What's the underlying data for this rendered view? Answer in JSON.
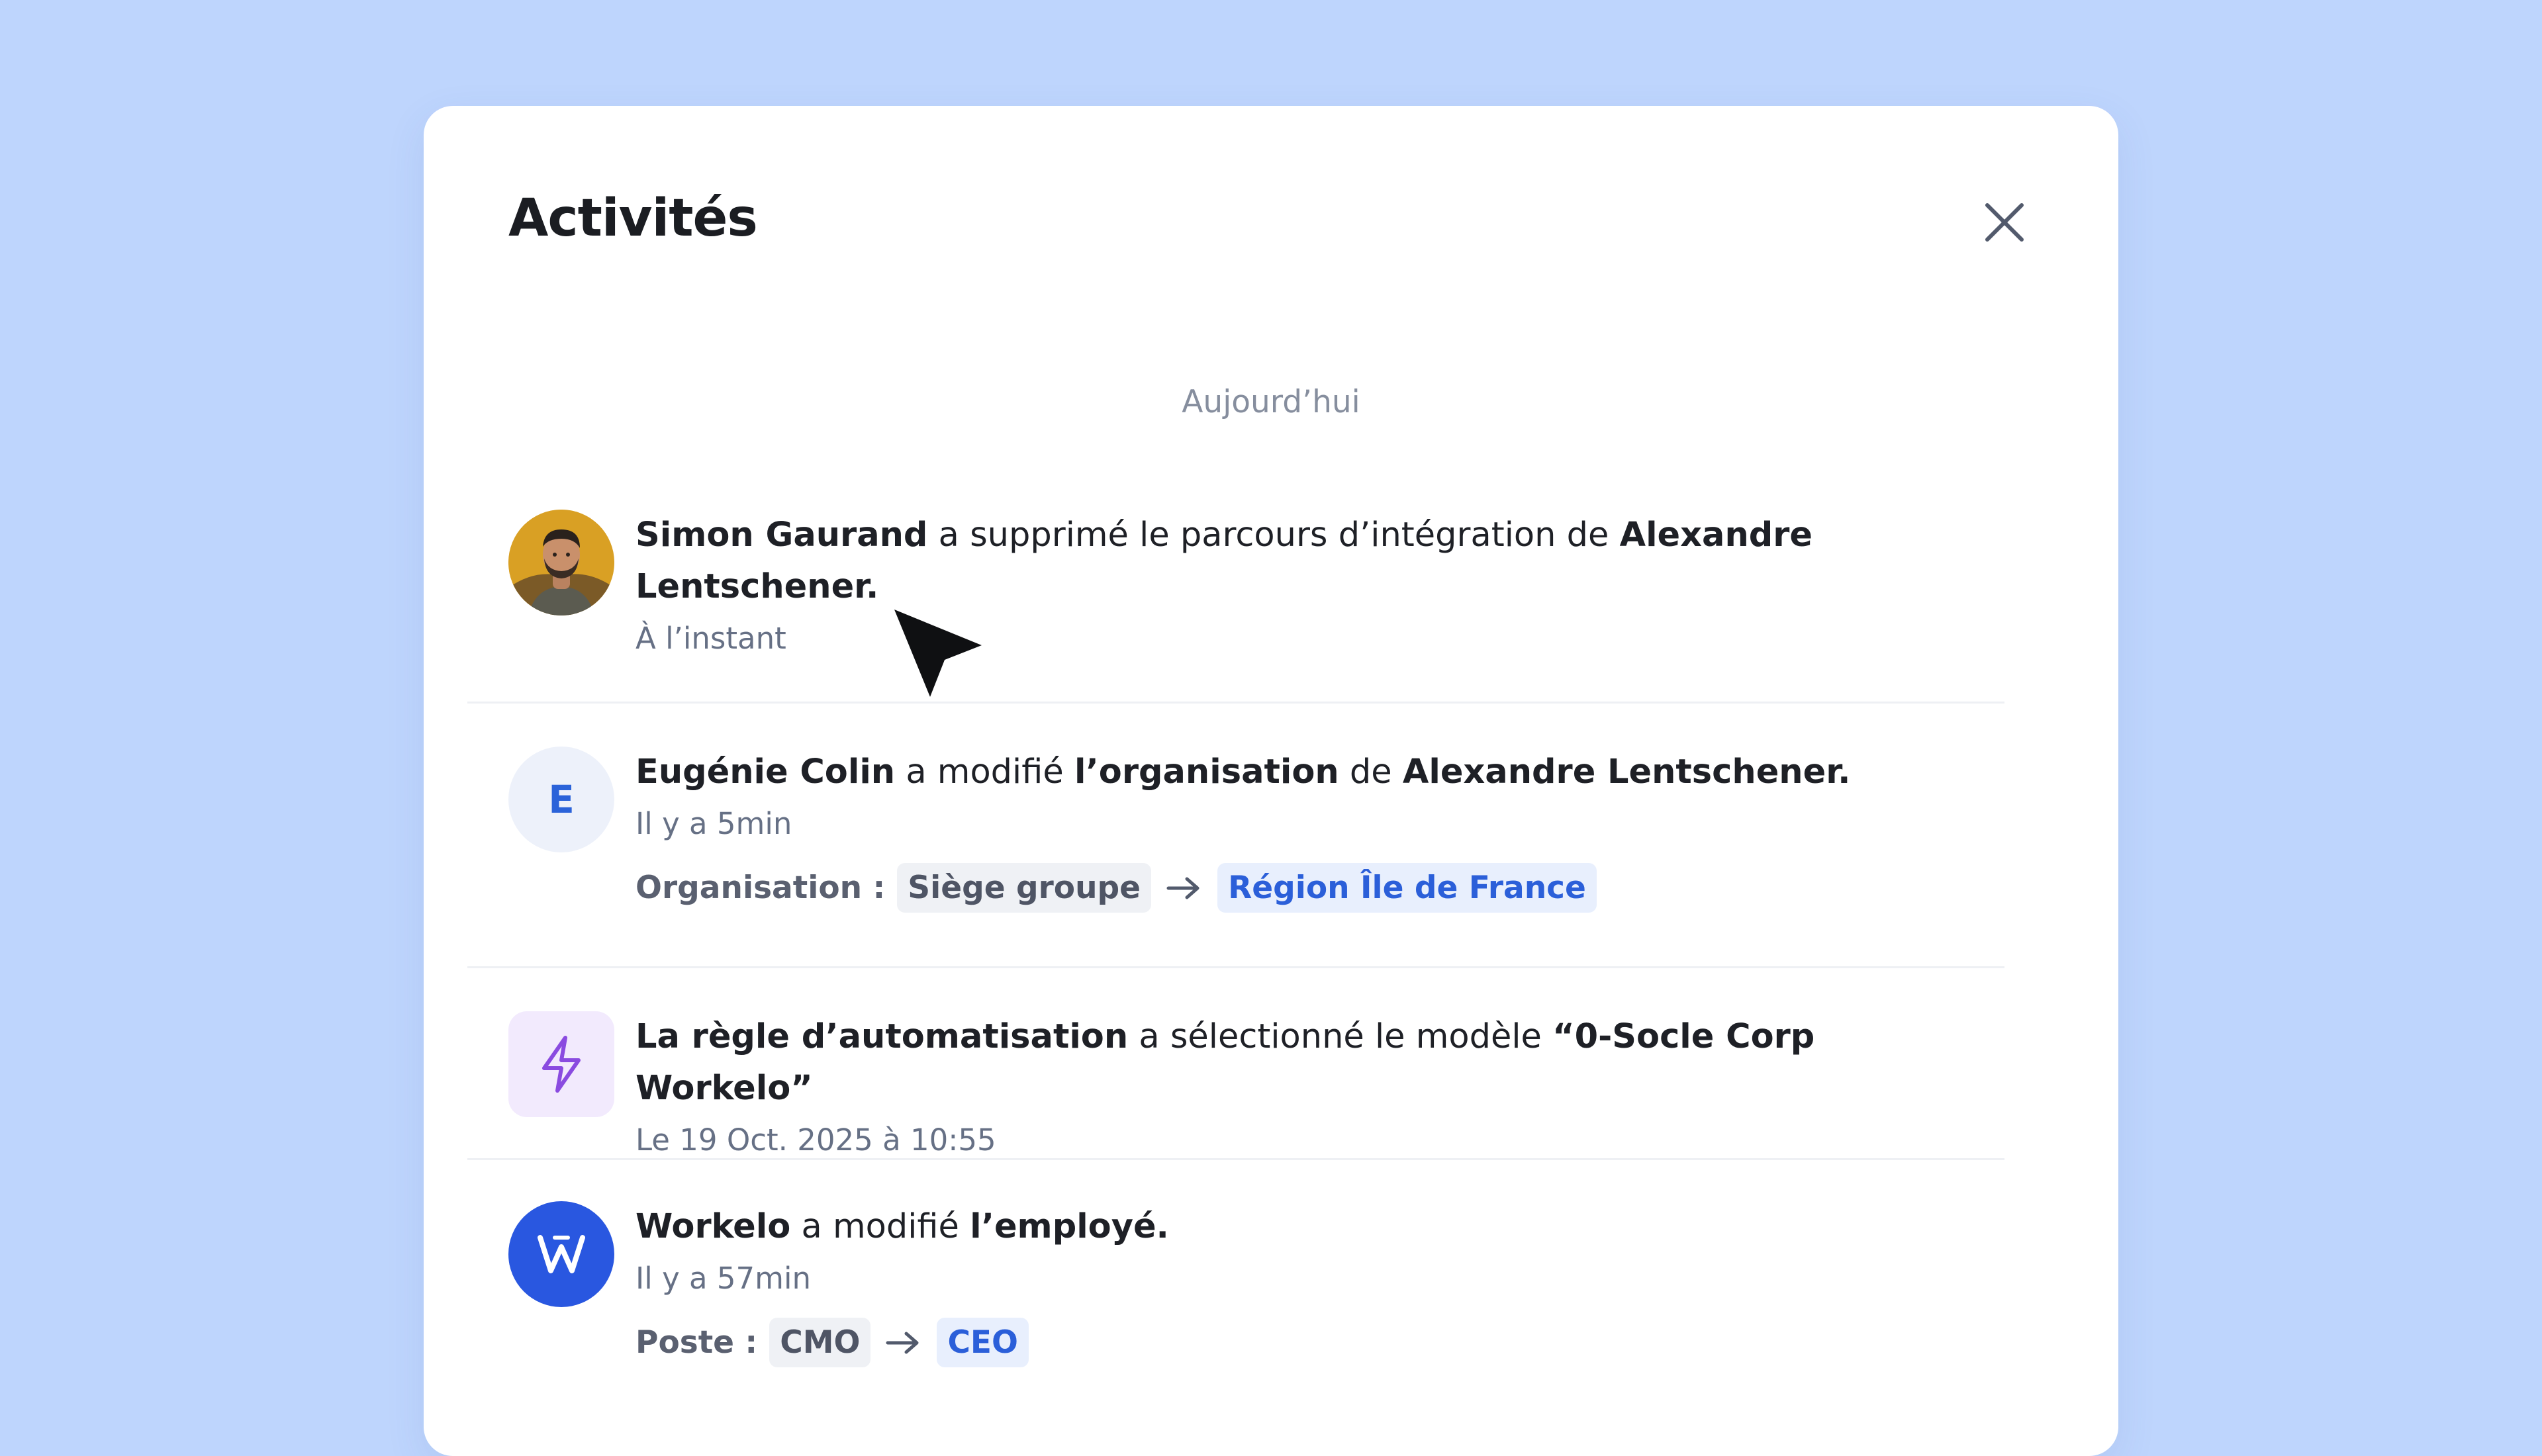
{
  "modal": {
    "title": "Activités",
    "close_label": "Fermer",
    "day_label": "Aujourd’hui"
  },
  "activities": [
    {
      "actor": "Simon Gaurand",
      "action": " a supprimé le parcours d’intégration de ",
      "target": "Alexandre Lentschener.",
      "time": "À l’instant",
      "avatar": {
        "type": "photo"
      }
    },
    {
      "actor": "Eugénie Colin",
      "action": " a modifié ",
      "object": "l’organisation",
      "connector": " de ",
      "target": "Alexandre Lentschener.",
      "time": "Il y a 5min",
      "avatar": {
        "type": "letter",
        "letter": "E"
      },
      "change": {
        "label": "Organisation :",
        "from": "Siège groupe",
        "to": "Région Île de France"
      }
    },
    {
      "actor": "La règle d’automatisation",
      "action": " a sélectionné le modèle ",
      "target": "“0-Socle Corp Workelo”",
      "time": "Le 19 Oct. 2025 à 10:55",
      "avatar": {
        "type": "icon",
        "icon": "lightning-bolt-icon",
        "color": "#8A4BE0"
      }
    },
    {
      "actor": "Workelo",
      "action": " a modifié ",
      "target": "l’employé.",
      "time": "Il y a 57min",
      "avatar": {
        "type": "brand",
        "letter": "W",
        "color": "#2957E0"
      },
      "change": {
        "label": "Poste :",
        "from": "CMO",
        "to": "CEO"
      }
    }
  ],
  "colors": {
    "background": "#BED5FD",
    "accent": "#2B63D9",
    "text": "#1E2026",
    "muted": "#667085"
  }
}
